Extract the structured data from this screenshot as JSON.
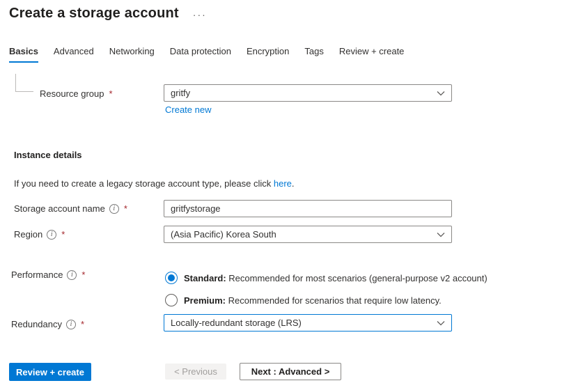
{
  "header": {
    "title": "Create a storage account",
    "more_label": "···"
  },
  "tabs": [
    {
      "label": "Basics",
      "active": true
    },
    {
      "label": "Advanced",
      "active": false
    },
    {
      "label": "Networking",
      "active": false
    },
    {
      "label": "Data protection",
      "active": false
    },
    {
      "label": "Encryption",
      "active": false
    },
    {
      "label": "Tags",
      "active": false
    },
    {
      "label": "Review + create",
      "active": false
    }
  ],
  "icons": {
    "info_glyph": "i",
    "required_glyph": "*"
  },
  "form": {
    "resource_group": {
      "label": "Resource group",
      "value": "gritfy",
      "create_new_label": "Create new"
    },
    "instance_details_heading": "Instance details",
    "legacy_notice": {
      "text_before": "If you need to create a legacy storage account type, please click ",
      "link_label": "here",
      "text_after": "."
    },
    "storage_account_name": {
      "label": "Storage account name",
      "value": "gritfystorage"
    },
    "region": {
      "label": "Region",
      "value": "(Asia Pacific) Korea South"
    },
    "performance": {
      "label": "Performance",
      "options": [
        {
          "name": "Standard:",
          "description": "Recommended for most scenarios (general-purpose v2 account)",
          "selected": true
        },
        {
          "name": "Premium:",
          "description": "Recommended for scenarios that require low latency.",
          "selected": false
        }
      ]
    },
    "redundancy": {
      "label": "Redundancy",
      "value": "Locally-redundant storage (LRS)"
    }
  },
  "footer": {
    "review_create_label": "Review + create",
    "previous_label": "< Previous",
    "next_label": "Next : Advanced >"
  },
  "colors": {
    "accent": "#0078d4",
    "required": "#a4262c"
  }
}
